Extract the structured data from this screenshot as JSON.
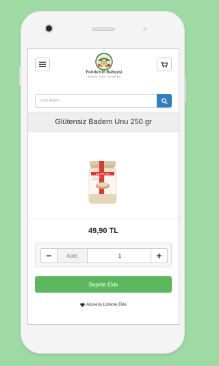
{
  "header": {
    "menu_icon": "hamburger-icon",
    "cart_icon": "cart-icon",
    "logo": {
      "name": "Feride'nin Bahçesi",
      "tagline": "ORGANIK · DOGAL · KAHVALTILIK"
    }
  },
  "search": {
    "placeholder": "Ürün arayın...",
    "value": "",
    "icon": "search-icon"
  },
  "product": {
    "title": "Glütensiz Badem Unu 250 gr",
    "price": "49,90 TL",
    "jar_label": "BADEM UNU"
  },
  "quantity": {
    "label": "Adet",
    "value": "1",
    "minus": "−",
    "plus": "+"
  },
  "actions": {
    "add_to_cart": "Sepete Ekle",
    "wishlist": "Alışveriş Listeme Ekle",
    "wishlist_icon": "heart-icon"
  },
  "colors": {
    "background": "#9fd9a4",
    "primary_blue": "#2f7fc1",
    "success_green": "#5cb85c"
  }
}
